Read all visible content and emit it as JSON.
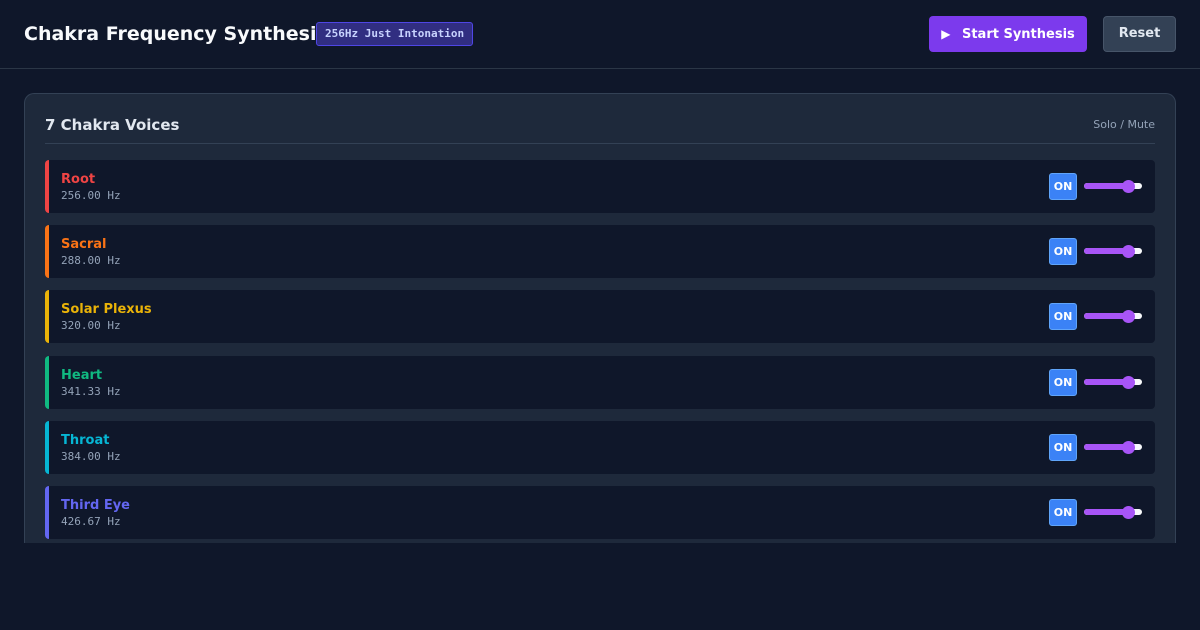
{
  "header": {
    "title": "Chakra Frequency Synthesizer",
    "tuning_badge": "256Hz Just Intonation",
    "start_label": "Start Synthesis",
    "reset_label": "Reset"
  },
  "panel": {
    "title": "7 Chakra Voices",
    "hint": "Solo / Mute"
  },
  "voices": [
    {
      "name": "Root",
      "frequency": "256.00 Hz",
      "toggle_label": "ON",
      "color": "#ef4444",
      "volume": 0.75
    },
    {
      "name": "Sacral",
      "frequency": "288.00 Hz",
      "toggle_label": "ON",
      "color": "#f97316",
      "volume": 0.75
    },
    {
      "name": "Solar Plexus",
      "frequency": "320.00 Hz",
      "toggle_label": "ON",
      "color": "#eab308",
      "volume": 0.75
    },
    {
      "name": "Heart",
      "frequency": "341.33 Hz",
      "toggle_label": "ON",
      "color": "#10b981",
      "volume": 0.75
    },
    {
      "name": "Throat",
      "frequency": "384.00 Hz",
      "toggle_label": "ON",
      "color": "#06b6d4",
      "volume": 0.75
    },
    {
      "name": "Third Eye",
      "frequency": "426.67 Hz",
      "toggle_label": "ON",
      "color": "#6366f1",
      "volume": 0.75
    }
  ],
  "colors": {
    "accent": "#7c3aed",
    "toggle_on": "#3b82f6",
    "slider": "#a855f7"
  },
  "icons": {
    "start": "play-icon"
  }
}
